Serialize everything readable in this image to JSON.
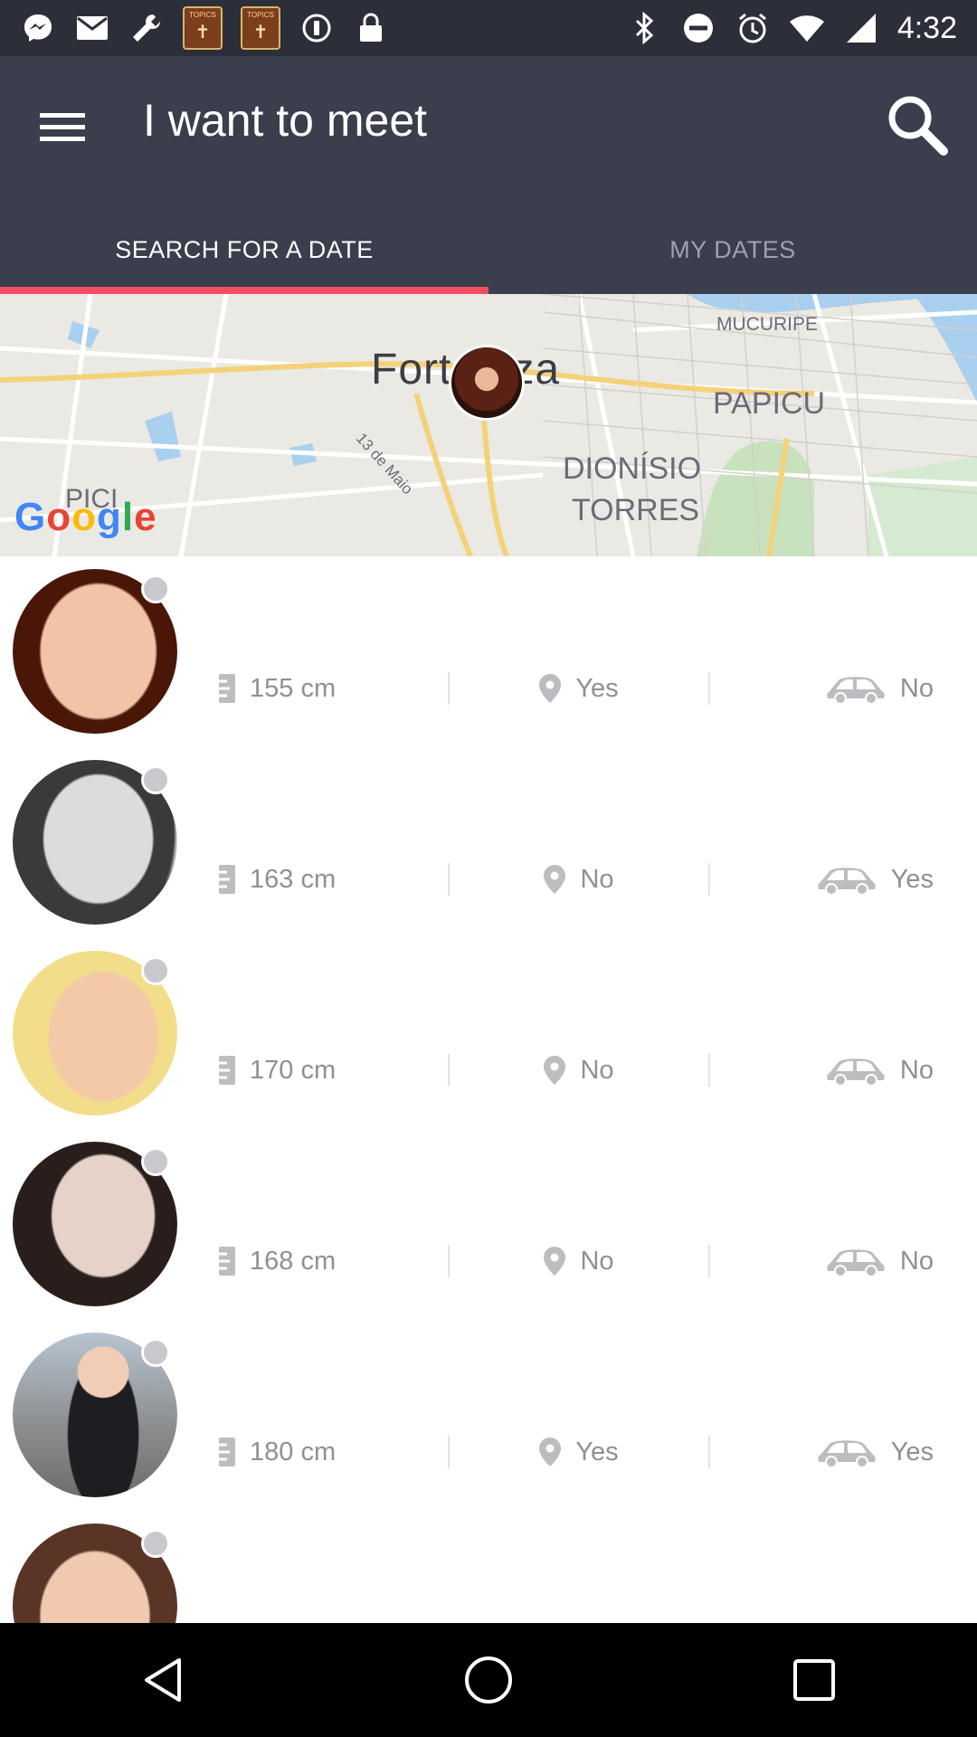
{
  "status_bar": {
    "time": "4:32",
    "app_badge_label": "TOPICS",
    "left_icons": [
      "messenger-icon",
      "mail-icon",
      "wrench-icon",
      "topics-app-icon",
      "topics-app-icon",
      "blocked-icon",
      "lock-icon"
    ],
    "right_icons": [
      "bluetooth-icon",
      "do-not-disturb-icon",
      "alarm-icon",
      "wifi-icon",
      "signal-icon"
    ]
  },
  "app_bar": {
    "title": "I want to meet",
    "menu_icon": "hamburger-menu-icon",
    "search_icon": "search-icon",
    "background": "#3a3e4d"
  },
  "tabs": [
    {
      "label": "SEARCH FOR A DATE",
      "active": true
    },
    {
      "label": "MY DATES",
      "active": false
    }
  ],
  "accent_color": "#f14e63",
  "map": {
    "labels": {
      "city": "Fortaleza",
      "mucuripe": "MUCURIPE",
      "papicu": "PAPICU",
      "dionisio": "DIONÍSIO",
      "torres": "TORRES",
      "street": "13 de Maio",
      "pici": "PICI"
    },
    "logo_text": "Google"
  },
  "profiles": [
    {
      "height": "155 cm",
      "location": "Yes",
      "car": "No"
    },
    {
      "height": "163 cm",
      "location": "No",
      "car": "Yes"
    },
    {
      "height": "170 cm",
      "location": "No",
      "car": "No"
    },
    {
      "height": "168 cm",
      "location": "No",
      "car": "No"
    },
    {
      "height": "180 cm",
      "location": "Yes",
      "car": "Yes"
    }
  ],
  "nav_bar": {
    "buttons": [
      "back-icon",
      "home-icon",
      "recents-icon"
    ]
  }
}
